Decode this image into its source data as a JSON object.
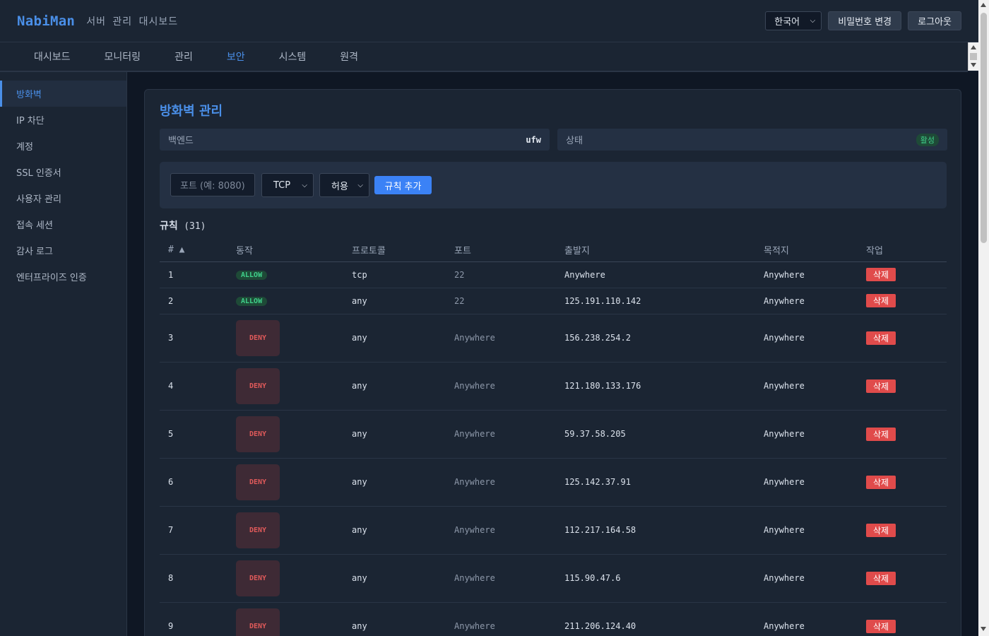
{
  "header": {
    "logo": "NabiMan",
    "subtitle": "서버 관리 대시보드",
    "language": "한국어",
    "change_password": "비밀번호 변경",
    "logout": "로그아웃"
  },
  "nav": {
    "items": [
      "대시보드",
      "모니터링",
      "관리",
      "보안",
      "시스템",
      "원격"
    ],
    "active": "보안"
  },
  "sidebar": {
    "items": [
      "방화벽",
      "IP 차단",
      "계정",
      "SSL 인증서",
      "사용자 관리",
      "접속 세션",
      "감사 로그",
      "엔터프라이즈 인증"
    ],
    "active": "방화벽"
  },
  "panel": {
    "title": "방화벽 관리",
    "backend_label": "백엔드",
    "backend_value": "ufw",
    "status_label": "상태",
    "status_value": "활성"
  },
  "form": {
    "port_placeholder": "포트 (예: 8080)",
    "protocol": "TCP",
    "action": "허용",
    "add_button": "규칙 추가"
  },
  "rules": {
    "title": "규칙",
    "count": "(31)",
    "columns": [
      "# ▲",
      "동작",
      "프로토콜",
      "포트",
      "출발지",
      "목적지",
      "작업"
    ],
    "delete_label": "삭제",
    "rows": [
      {
        "num": "1",
        "action": "ALLOW",
        "protocol": "tcp",
        "port": "22",
        "from": "Anywhere",
        "to": "Anywhere"
      },
      {
        "num": "2",
        "action": "ALLOW",
        "protocol": "any",
        "port": "22",
        "from": "125.191.110.142",
        "to": "Anywhere"
      },
      {
        "num": "3",
        "action": "DENY",
        "protocol": "any",
        "port": "Anywhere",
        "from": "156.238.254.2",
        "to": "Anywhere"
      },
      {
        "num": "4",
        "action": "DENY",
        "protocol": "any",
        "port": "Anywhere",
        "from": "121.180.133.176",
        "to": "Anywhere"
      },
      {
        "num": "5",
        "action": "DENY",
        "protocol": "any",
        "port": "Anywhere",
        "from": "59.37.58.205",
        "to": "Anywhere"
      },
      {
        "num": "6",
        "action": "DENY",
        "protocol": "any",
        "port": "Anywhere",
        "from": "125.142.37.91",
        "to": "Anywhere"
      },
      {
        "num": "7",
        "action": "DENY",
        "protocol": "any",
        "port": "Anywhere",
        "from": "112.217.164.58",
        "to": "Anywhere"
      },
      {
        "num": "8",
        "action": "DENY",
        "protocol": "any",
        "port": "Anywhere",
        "from": "115.90.47.6",
        "to": "Anywhere"
      },
      {
        "num": "9",
        "action": "DENY",
        "protocol": "any",
        "port": "Anywhere",
        "from": "211.206.124.40",
        "to": "Anywhere"
      }
    ]
  }
}
